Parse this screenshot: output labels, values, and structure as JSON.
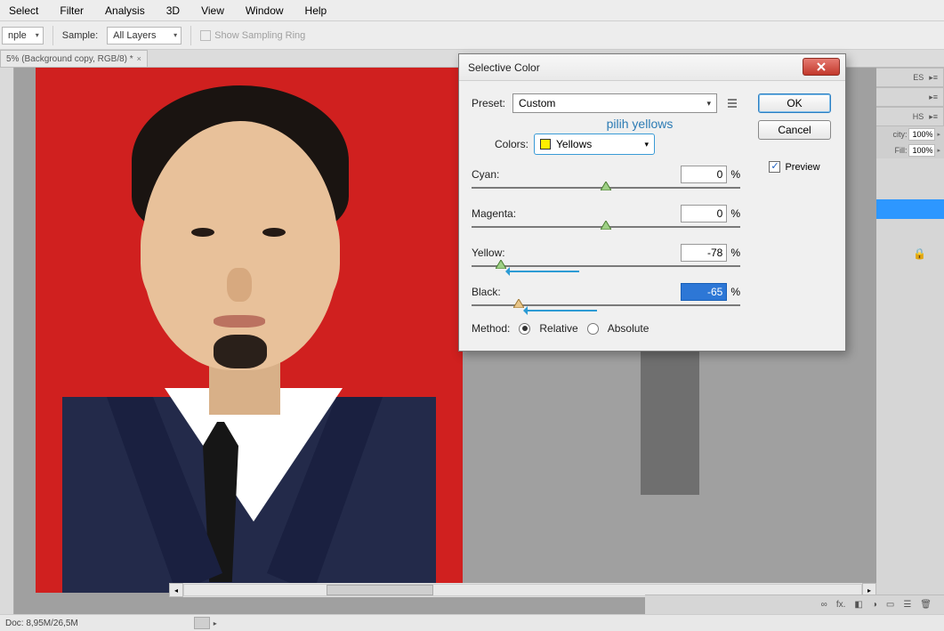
{
  "menubar": [
    "Select",
    "Filter",
    "Analysis",
    "3D",
    "View",
    "Window",
    "Help"
  ],
  "options": {
    "sample_mode": "nple",
    "sample_label": "Sample:",
    "sample_value": "All Layers",
    "show_sampling": "Show Sampling Ring"
  },
  "doc_tab": "5% (Background copy, RGB/8) *",
  "right": {
    "tab_es": "ES",
    "tab_hs": "HS",
    "opacity_label": "city:",
    "opacity_value": "100%",
    "fill_label": "Fill:",
    "fill_value": "100%"
  },
  "statusbar": {
    "doc": "Doc: 8,95M/26,5M"
  },
  "dialog": {
    "title": "Selective Color",
    "ok": "OK",
    "cancel": "Cancel",
    "preview": "Preview",
    "preset_label": "Preset:",
    "preset_value": "Custom",
    "annotation": "pilih yellows",
    "colors_label": "Colors:",
    "colors_value": "Yellows",
    "sliders": {
      "cyan": {
        "label": "Cyan:",
        "value": "0"
      },
      "magenta": {
        "label": "Magenta:",
        "value": "0"
      },
      "yellow": {
        "label": "Yellow:",
        "value": "-78"
      },
      "black": {
        "label": "Black:",
        "value": "-65"
      }
    },
    "pct": "%",
    "method_label": "Method:",
    "relative": "Relative",
    "absolute": "Absolute"
  },
  "bottom_icons": [
    "∞",
    "fx.",
    "◧",
    "◑",
    "▭",
    "☰",
    "🗑"
  ]
}
